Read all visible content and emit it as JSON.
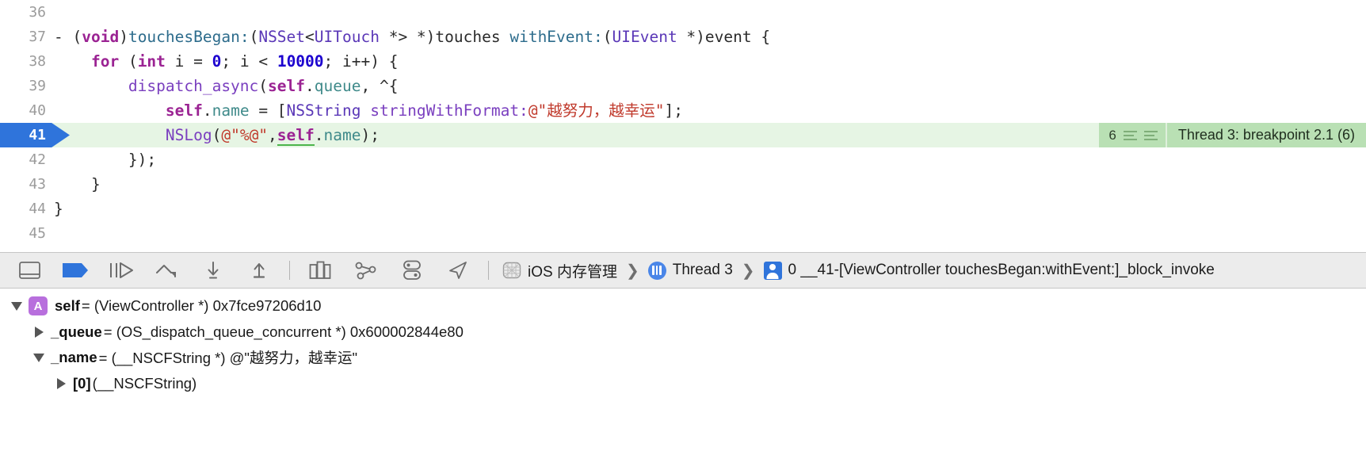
{
  "editor": {
    "lines": [
      {
        "number": "36",
        "highlight": false,
        "tokens": []
      },
      {
        "number": "37",
        "highlight": false,
        "tokens": [
          {
            "t": "- (",
            "c": "plain"
          },
          {
            "t": "void",
            "c": "kw"
          },
          {
            "t": ")",
            "c": "plain"
          },
          {
            "t": "touchesBegan:",
            "c": "sel"
          },
          {
            "t": "(",
            "c": "plain"
          },
          {
            "t": "NSSet",
            "c": "type"
          },
          {
            "t": "<",
            "c": "plain"
          },
          {
            "t": "UITouch",
            "c": "type"
          },
          {
            "t": " *> *)",
            "c": "plain"
          },
          {
            "t": "touches ",
            "c": "plain"
          },
          {
            "t": "withEvent:",
            "c": "sel"
          },
          {
            "t": "(",
            "c": "plain"
          },
          {
            "t": "UIEvent",
            "c": "type"
          },
          {
            "t": " *)",
            "c": "plain"
          },
          {
            "t": "event {",
            "c": "plain"
          }
        ]
      },
      {
        "number": "38",
        "highlight": false,
        "tokens": [
          {
            "t": "    ",
            "c": "plain"
          },
          {
            "t": "for",
            "c": "kw"
          },
          {
            "t": " (",
            "c": "plain"
          },
          {
            "t": "int",
            "c": "kw"
          },
          {
            "t": " i = ",
            "c": "plain"
          },
          {
            "t": "0",
            "c": "num"
          },
          {
            "t": "; i < ",
            "c": "plain"
          },
          {
            "t": "10000",
            "c": "num"
          },
          {
            "t": "; i++) {",
            "c": "plain"
          }
        ]
      },
      {
        "number": "39",
        "highlight": false,
        "tokens": [
          {
            "t": "        ",
            "c": "plain"
          },
          {
            "t": "dispatch_async",
            "c": "fn"
          },
          {
            "t": "(",
            "c": "plain"
          },
          {
            "t": "self",
            "c": "selfkw"
          },
          {
            "t": ".",
            "c": "plain"
          },
          {
            "t": "queue",
            "c": "prop"
          },
          {
            "t": ", ^{",
            "c": "plain"
          }
        ]
      },
      {
        "number": "40",
        "highlight": false,
        "tokens": [
          {
            "t": "            ",
            "c": "plain"
          },
          {
            "t": "self",
            "c": "selfkw"
          },
          {
            "t": ".",
            "c": "plain"
          },
          {
            "t": "name",
            "c": "prop"
          },
          {
            "t": " = [",
            "c": "plain"
          },
          {
            "t": "NSString",
            "c": "type"
          },
          {
            "t": " ",
            "c": "plain"
          },
          {
            "t": "stringWithFormat:",
            "c": "fn"
          },
          {
            "t": "@\"越努力，越幸运\"",
            "c": "str"
          },
          {
            "t": "];",
            "c": "plain"
          }
        ]
      },
      {
        "number": "41",
        "highlight": true,
        "tokens": [
          {
            "t": "            ",
            "c": "plain"
          },
          {
            "t": "NSLog",
            "c": "fn"
          },
          {
            "t": "(",
            "c": "plain"
          },
          {
            "t": "@\"%@\"",
            "c": "str"
          },
          {
            "t": ",",
            "c": "plain"
          },
          {
            "t": "self",
            "c": "selfhit"
          },
          {
            "t": ".",
            "c": "plain"
          },
          {
            "t": "name",
            "c": "prop"
          },
          {
            "t": ");",
            "c": "plain"
          }
        ]
      },
      {
        "number": "42",
        "highlight": false,
        "tokens": [
          {
            "t": "        });",
            "c": "plain"
          }
        ]
      },
      {
        "number": "43",
        "highlight": false,
        "tokens": [
          {
            "t": "    }",
            "c": "plain"
          }
        ]
      },
      {
        "number": "44",
        "highlight": false,
        "tokens": [
          {
            "t": "}",
            "c": "plain"
          }
        ]
      },
      {
        "number": "45",
        "highlight": false,
        "tokens": []
      }
    ],
    "annotation": {
      "count": "6",
      "label": "Thread 3: breakpoint 2.1 (6)"
    }
  },
  "debug_bar": {
    "buttons": [
      {
        "name": "toggle-debug-area-button",
        "icon": "panel-toggle-icon"
      },
      {
        "name": "deactivate-breakpoints-button",
        "icon": "breakpoint-flag-icon"
      },
      {
        "name": "continue-button",
        "icon": "continue-icon"
      },
      {
        "name": "step-over-button",
        "icon": "step-over-icon"
      },
      {
        "name": "step-into-button",
        "icon": "step-into-icon"
      },
      {
        "name": "step-out-button",
        "icon": "step-out-icon"
      },
      {
        "name": "view-hierarchy-button",
        "icon": "view-hierarchy-icon"
      },
      {
        "name": "memory-graph-button",
        "icon": "memory-graph-icon"
      },
      {
        "name": "environment-overrides-button",
        "icon": "environment-overrides-icon"
      },
      {
        "name": "simulate-location-button",
        "icon": "location-arrow-icon"
      }
    ],
    "breadcrumb": [
      {
        "label": "iOS 内存管理",
        "icon": "process-grid-icon"
      },
      {
        "label": "Thread 3",
        "icon": "thread-icon"
      },
      {
        "label": "0 __41-[ViewController touchesBegan:withEvent:]_block_invoke",
        "icon": "stack-frame-icon"
      }
    ],
    "chevron": "❯"
  },
  "variables": [
    {
      "indent": 0,
      "disclosure": "open",
      "badge": "A",
      "name": "self",
      "rest": " = (ViewController *) 0x7fce97206d10"
    },
    {
      "indent": 1,
      "disclosure": "closed",
      "badge": "",
      "name": "_queue",
      "rest": " = (OS_dispatch_queue_concurrent *) 0x600002844e80"
    },
    {
      "indent": 1,
      "disclosure": "open",
      "badge": "",
      "name": "_name",
      "rest": " = (__NSCFString *) @\"越努力，越幸运\""
    },
    {
      "indent": 2,
      "disclosure": "closed",
      "badge": "",
      "name": "[0]",
      "rest": " (__NSCFString)"
    }
  ],
  "colors": {
    "breakpoint_blue": "#2f74db",
    "highlight_green": "#e6f5e4",
    "annotation_green": "#b9e0b4",
    "badge_purple": "#b86fdd",
    "toolbar_gray": "#ececec"
  }
}
